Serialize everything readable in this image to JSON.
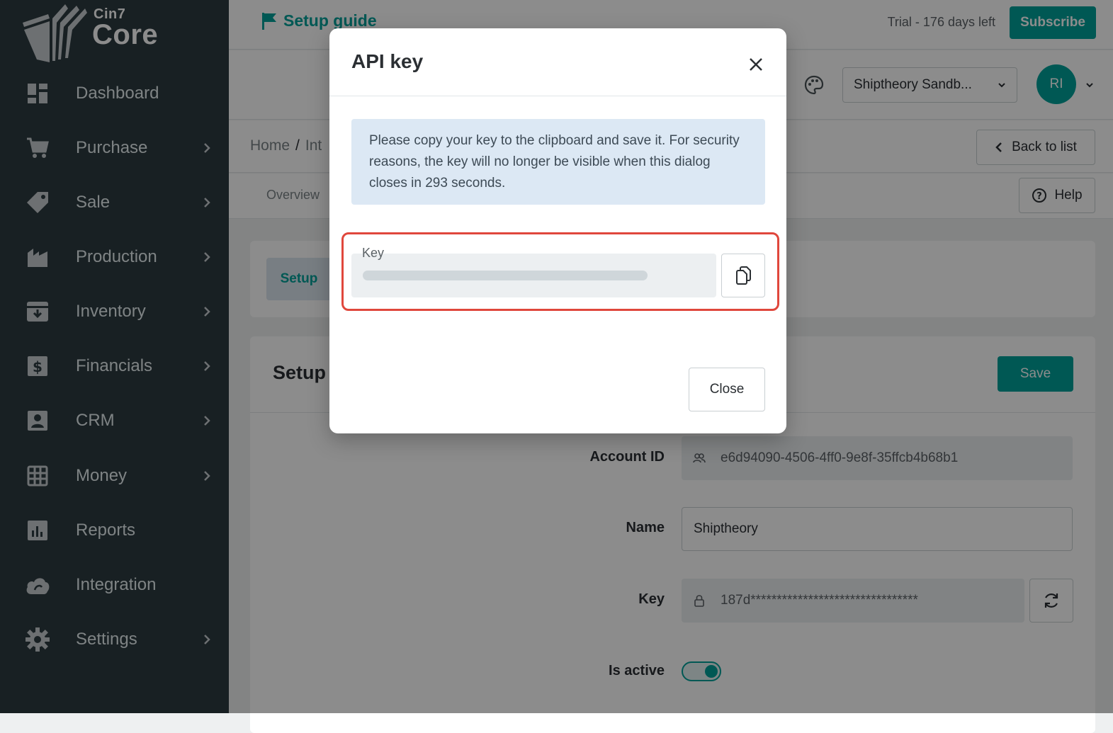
{
  "brand": {
    "small": "Cin7",
    "big": "Core"
  },
  "colors": {
    "sidebar": "#2d3b41",
    "accent": "#00a19a",
    "highlight": "#e0473c",
    "notice": "#dce8f4"
  },
  "sidebar": {
    "items": [
      {
        "label": "Dashboard",
        "icon": "dashboard-icon",
        "chevron": false
      },
      {
        "label": "Purchase",
        "icon": "cart-icon",
        "chevron": true
      },
      {
        "label": "Sale",
        "icon": "tag-icon",
        "chevron": true
      },
      {
        "label": "Production",
        "icon": "factory-icon",
        "chevron": true
      },
      {
        "label": "Inventory",
        "icon": "inventory-box-icon",
        "chevron": true
      },
      {
        "label": "Financials",
        "icon": "dollar-doc-icon",
        "chevron": true
      },
      {
        "label": "CRM",
        "icon": "contact-card-icon",
        "chevron": true
      },
      {
        "label": "Money",
        "icon": "ledger-grid-icon",
        "chevron": true
      },
      {
        "label": "Reports",
        "icon": "bar-chart-icon",
        "chevron": false
      },
      {
        "label": "Integration",
        "icon": "cloud-icon",
        "chevron": false
      },
      {
        "label": "Settings",
        "icon": "gear-icon",
        "chevron": true
      }
    ]
  },
  "header": {
    "setup_guide": "Setup guide",
    "trial": "Trial - 176 days left",
    "subscribe": "Subscribe",
    "org": "Shiptheory Sandb...",
    "avatar": "RI"
  },
  "breadcrumb": {
    "home": "Home",
    "sep": "/",
    "current": "Int"
  },
  "back_to_list": "Back to list",
  "tabs": {
    "overview": "Overview"
  },
  "help": "Help",
  "setup_tab": "Setup",
  "form": {
    "title": "Setup",
    "save": "Save",
    "account_id_label": "Account ID",
    "account_id_value": "e6d94090-4506-4ff0-9e8f-35ffcb4b68b1",
    "name_label": "Name",
    "name_value": "Shiptheory",
    "key_label": "Key",
    "key_value": "187d********************************",
    "active_label": "Is active",
    "active": true
  },
  "modal": {
    "title": "API key",
    "notice": "Please copy your key to the clipboard and save it. For security reasons, the key will no longer be visible when this dialog closes in 293 seconds.",
    "key_label": "Key",
    "close": "Close"
  }
}
